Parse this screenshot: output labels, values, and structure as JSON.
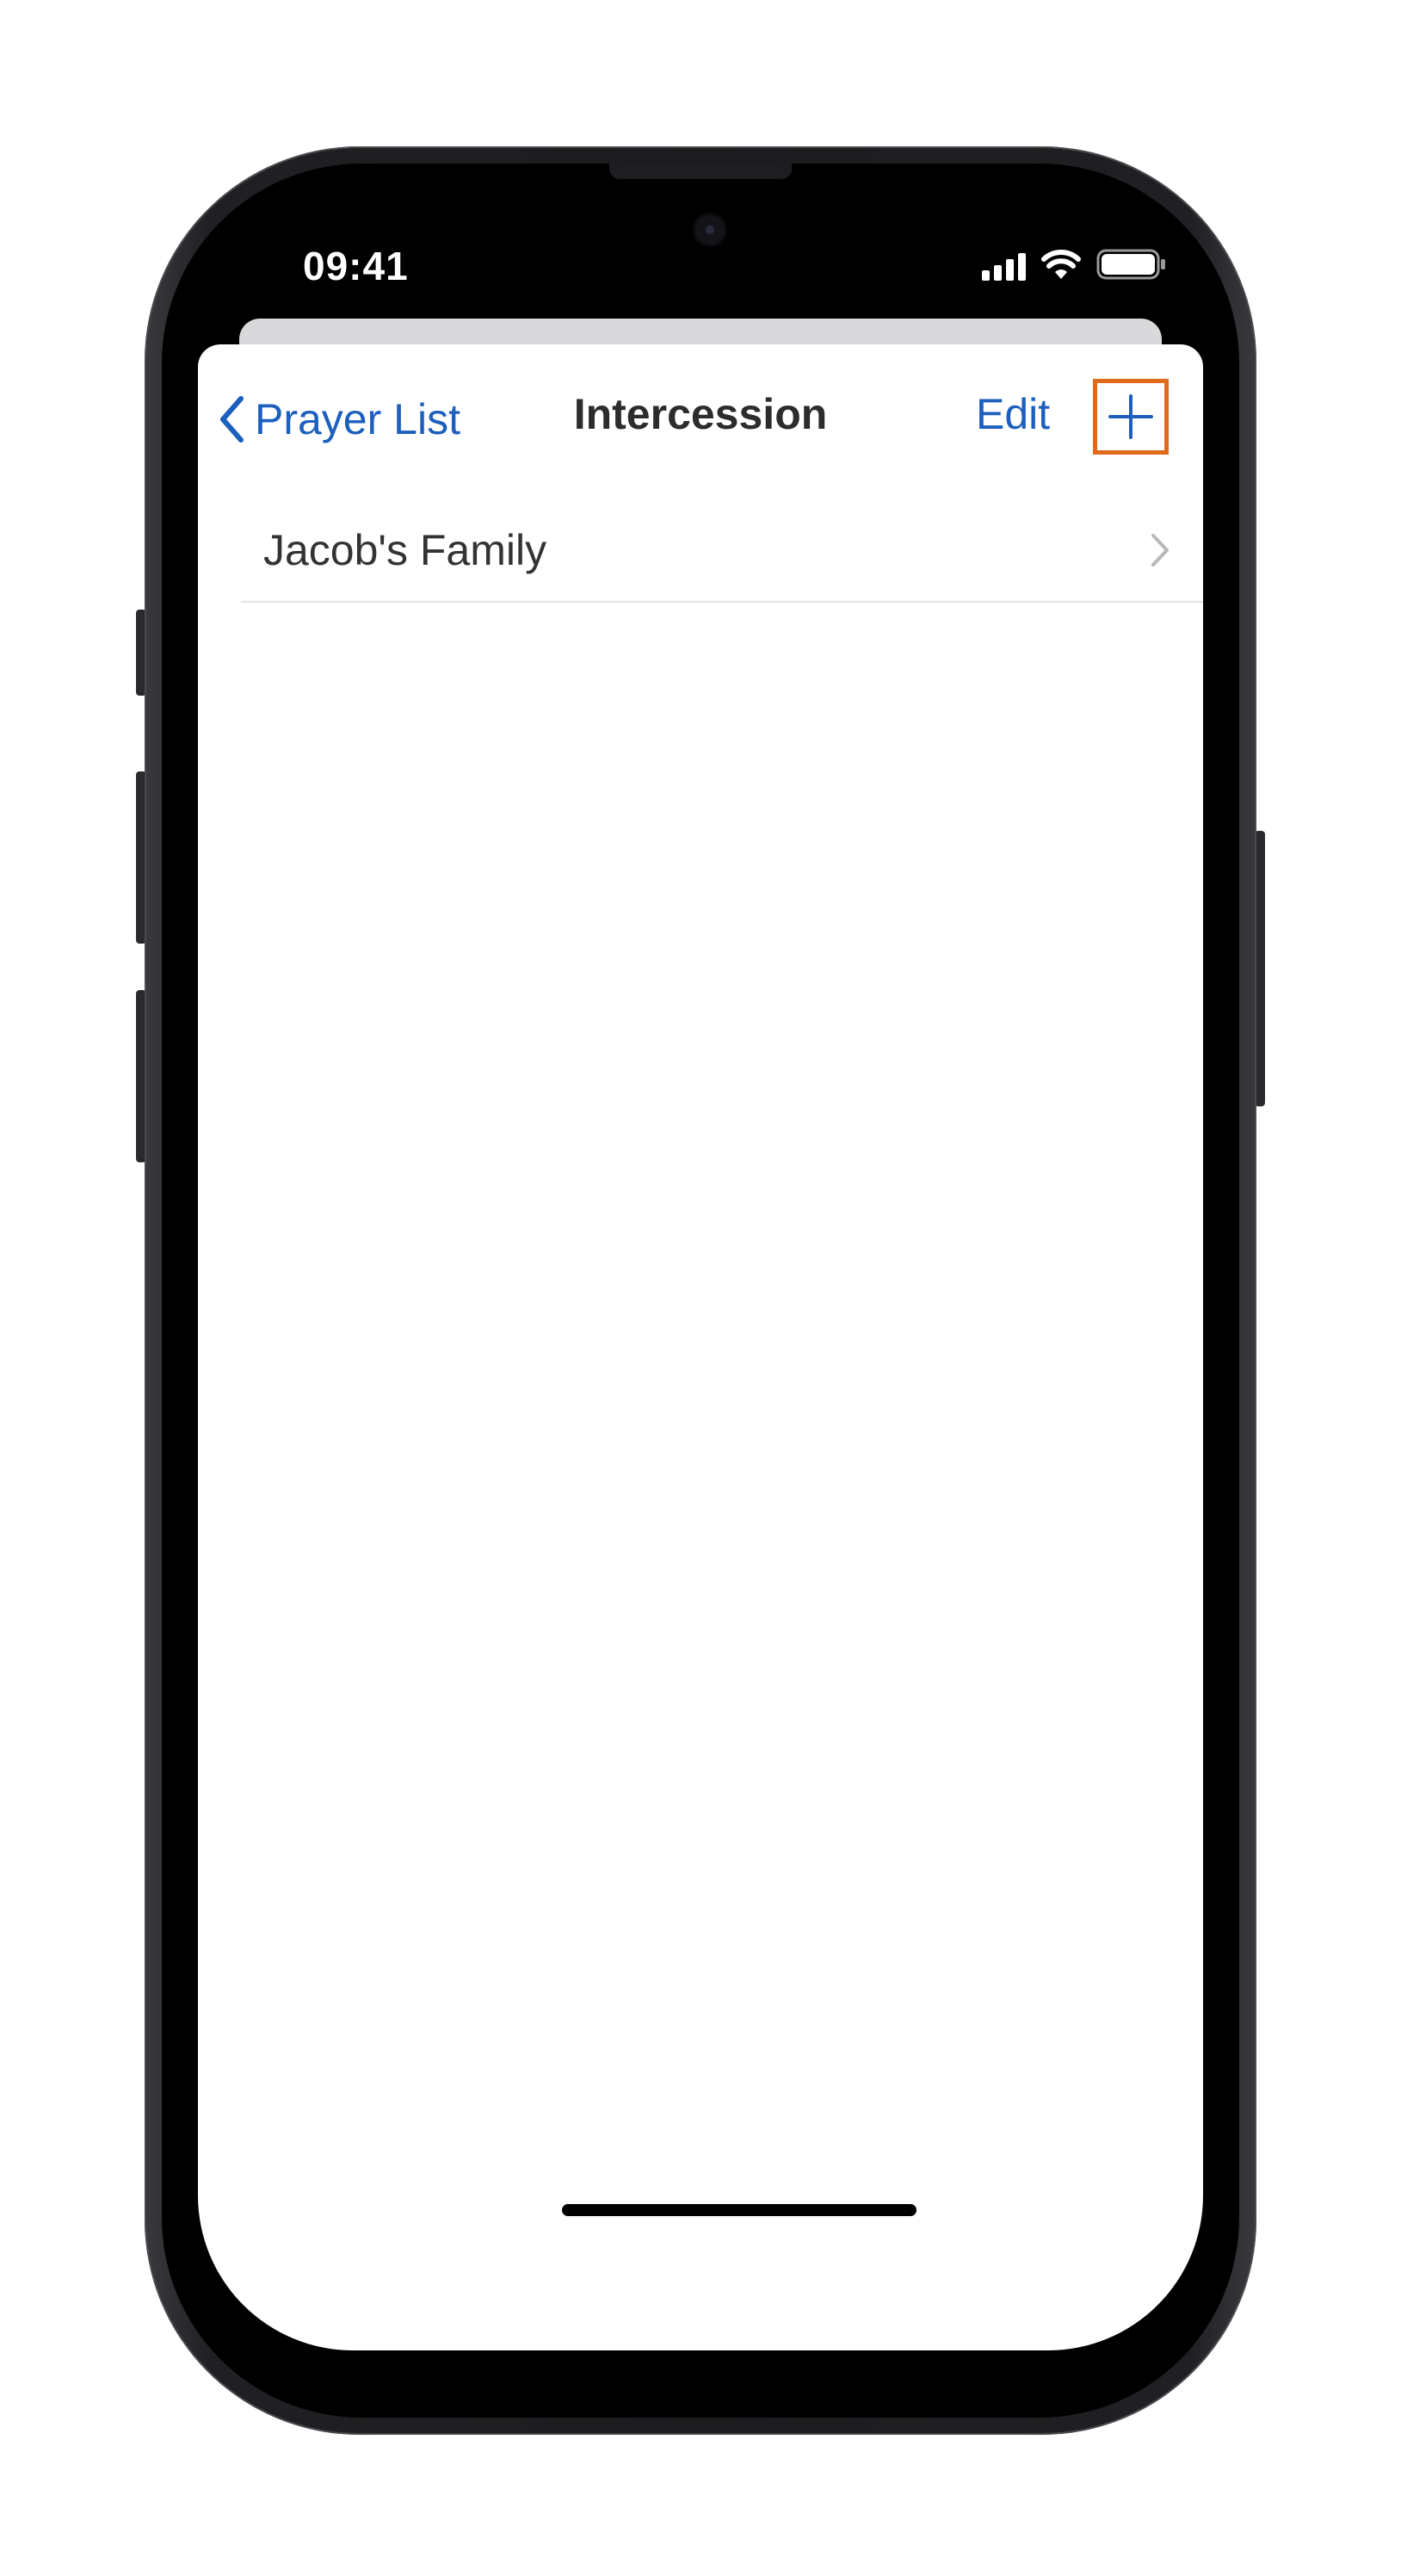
{
  "status_bar": {
    "time": "09:41",
    "icons": [
      "cellular-signal-icon",
      "wifi-icon",
      "battery-icon"
    ]
  },
  "nav_bar": {
    "back_label": "Prayer List",
    "back_icon": "chevron-left-icon",
    "title": "Intercession",
    "edit_label": "Edit",
    "add_icon": "plus-icon"
  },
  "list": {
    "items": [
      {
        "label": "Jacob's Family",
        "accessory": "chevron-right-icon"
      }
    ]
  },
  "colors": {
    "accent": "#1d5fbe",
    "highlight": "#e06a1b",
    "title": "#2c2c2e",
    "separator": "#e3e3e5"
  }
}
